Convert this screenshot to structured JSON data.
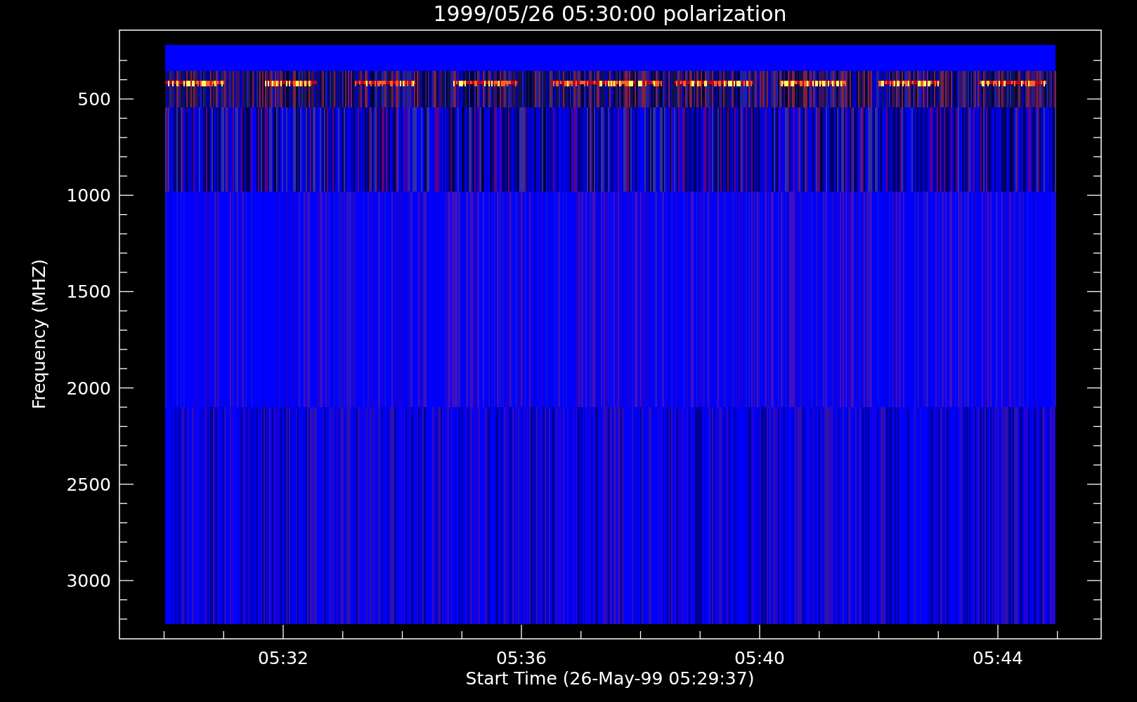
{
  "plot": {
    "title": "1999/05/26 05:30:00 polarization",
    "xlabel": "Start Time (26-May-99 05:29:37)",
    "ylabel": "Frequency (MHZ)",
    "yticks": [
      "500",
      "1000",
      "1500",
      "2000",
      "2500",
      "3000"
    ],
    "xticks": [
      "05:32",
      "05:36",
      "05:40",
      "05:44"
    ]
  }
}
